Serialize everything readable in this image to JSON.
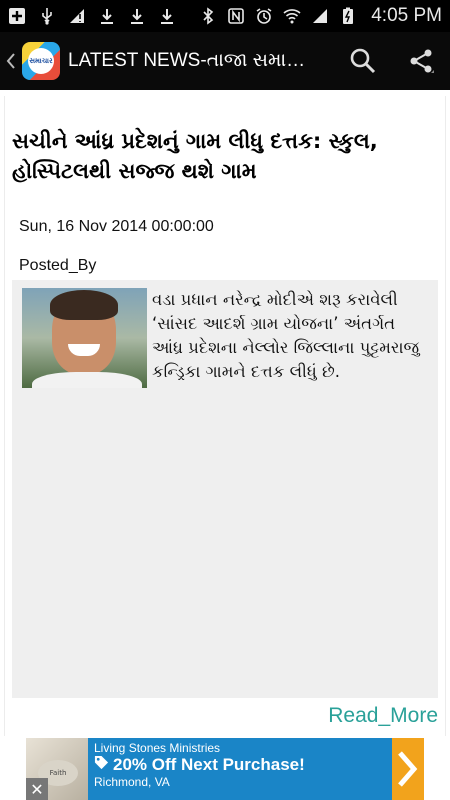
{
  "status_bar": {
    "time": "4:05 PM",
    "icons_left": [
      "add-box-icon",
      "usb-icon",
      "no-signal-icon",
      "download-icon",
      "download-icon",
      "download-icon"
    ],
    "icons_right": [
      "bluetooth-icon",
      "nfc-icon",
      "alarm-icon",
      "wifi-icon",
      "cell-signal-icon",
      "battery-charging-icon"
    ]
  },
  "action_bar": {
    "title": "LATEST NEWS-તાજા સમા…",
    "logo_text": "સમાચાર"
  },
  "article": {
    "headline": "સચીને આંધ્ર પ્રદેશનું ગામ લીધુ દત્તક: સ્કુલ, હોસ્પિટલથી સજ્જ થશે ગામ",
    "date": "Sun, 16 Nov 2014 00:00:00",
    "posted_by": "Posted_By",
    "body": "વડા પ્રધાન નરેન્દ્ર મોદીએ શરૂ કરાવેલી ‘સાંસદ આદર્શ ગ્રામ યોજના’ અંતર્ગત આંધ્ર પ્રદેશના નેલ્લોર જિલ્લાના પુટ્ટમરાજુ કન્ડ્રિકા ગામને દત્તક લીધું છે.",
    "read_more": "Read_More"
  },
  "ad": {
    "line1": "Living Stones Ministries",
    "line2": "20% Off Next Purchase!",
    "line3": "Richmond, VA",
    "thumb_text": "Faith",
    "close": "✕"
  },
  "colors": {
    "read_more": "#2aa199",
    "ad_bg": "#1a85c7",
    "ad_arrow": "#f2a31c"
  }
}
